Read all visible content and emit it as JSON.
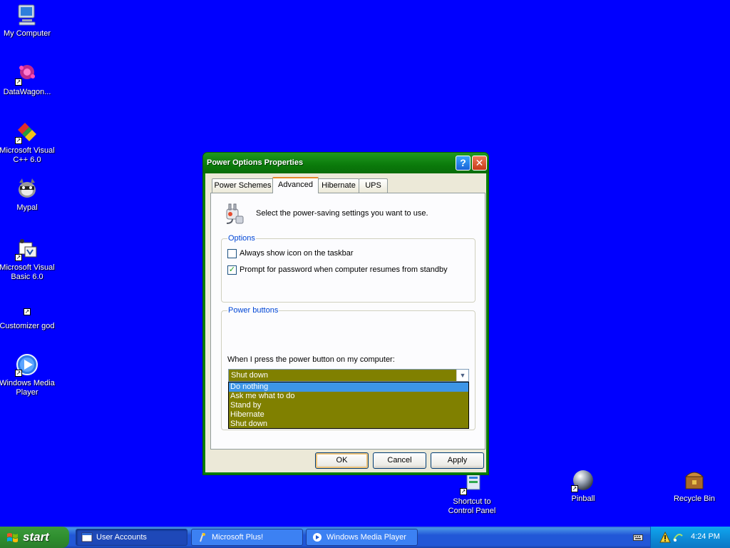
{
  "desktop": {
    "icons": [
      {
        "label": "My Computer",
        "icon": "my-computer-icon"
      },
      {
        "label": "DataWagon...",
        "icon": "datawagon-icon"
      },
      {
        "label": "Microsoft Visual C++ 6.0",
        "icon": "visual-cpp-icon"
      },
      {
        "label": "Mypal",
        "icon": "mypal-icon"
      },
      {
        "label": "Microsoft Visual Basic 6.0",
        "icon": "visual-basic-icon"
      },
      {
        "label": "Customizer god",
        "icon": "customizer-icon"
      },
      {
        "label": "Windows Media Player",
        "icon": "windows-media-player-icon"
      },
      {
        "label": "Shortcut to Control Panel",
        "icon": "control-panel-icon"
      },
      {
        "label": "Pinball",
        "icon": "pinball-icon"
      },
      {
        "label": "Recycle Bin",
        "icon": "recycle-bin-icon"
      }
    ]
  },
  "dialog": {
    "title": "Power Options Properties",
    "help_glyph": "?",
    "close_glyph": "✕",
    "tabs": [
      {
        "label": "Power Schemes",
        "active": false
      },
      {
        "label": "Advanced",
        "active": true
      },
      {
        "label": "Hibernate",
        "active": false
      },
      {
        "label": "UPS",
        "active": false
      }
    ],
    "header_text": "Select the power-saving settings you want to use.",
    "options_group": {
      "title": "Options",
      "checkboxes": [
        {
          "label": "Always show icon on the taskbar",
          "checked": false
        },
        {
          "label": "Prompt for password when computer resumes from standby",
          "checked": true
        }
      ]
    },
    "power_buttons_group": {
      "title": "Power buttons",
      "power_label": "When I press the power button on my computer:",
      "selected_value": "Shut down",
      "options": [
        "Do nothing",
        "Ask me what to do",
        "Stand by",
        "Hibernate",
        "Shut down"
      ],
      "highlighted_option": "Do nothing"
    },
    "buttons": {
      "ok": "OK",
      "cancel": "Cancel",
      "apply": "Apply"
    }
  },
  "taskbar": {
    "start_label": "start",
    "items": [
      {
        "label": "User Accounts",
        "active": true
      },
      {
        "label": "Microsoft Plus!",
        "active": false
      },
      {
        "label": "Windows Media Player",
        "active": false
      }
    ],
    "clock": "4:24 PM"
  },
  "colors": {
    "desktop_bg": "#0000ff",
    "title_green": "#0a7f0a",
    "dropdown_bg": "#808000",
    "selection_blue": "#3d95e6"
  }
}
